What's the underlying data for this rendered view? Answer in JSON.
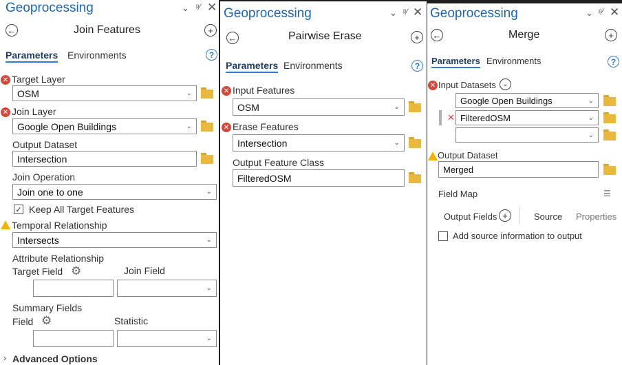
{
  "pane1": {
    "title": "Geoprocessing",
    "tool_name": "Join Features",
    "tab_parameters": "Parameters",
    "tab_environments": "Environments",
    "target_layer_label": "Target Layer",
    "target_layer_value": "OSM",
    "join_layer_label": "Join Layer",
    "join_layer_value": "Google Open Buildings",
    "output_dataset_label": "Output Dataset",
    "output_dataset_value": "Intersection",
    "join_operation_label": "Join Operation",
    "join_operation_value": "Join one to one",
    "keep_all_label": "Keep All Target Features",
    "keep_all_checked": true,
    "temporal_label": "Temporal Relationship",
    "temporal_value": "Intersects",
    "attr_rel_label": "Attribute Relationship",
    "target_field_label": "Target Field",
    "join_field_label": "Join Field",
    "summary_fields_label": "Summary Fields",
    "field_label": "Field",
    "statistic_label": "Statistic",
    "advanced_label": "Advanced Options"
  },
  "pane2": {
    "title": "Geoprocessing",
    "tool_name": "Pairwise Erase",
    "tab_parameters": "Parameters",
    "tab_environments": "Environments",
    "input_features_label": "Input Features",
    "input_features_value": "OSM",
    "erase_features_label": "Erase Features",
    "erase_features_value": "Intersection",
    "output_class_label": "Output Feature Class",
    "output_class_value": "FilteredOSM"
  },
  "pane3": {
    "title": "Geoprocessing",
    "tool_name": "Merge",
    "tab_parameters": "Parameters",
    "tab_environments": "Environments",
    "input_datasets_label": "Input Datasets",
    "input_datasets": [
      "Google Open Buildings",
      "FilteredOSM",
      ""
    ],
    "output_dataset_label": "Output Dataset",
    "output_dataset_value": "Merged",
    "field_map_label": "Field Map",
    "output_fields_label": "Output Fields",
    "source_tab": "Source",
    "properties_tab": "Properties",
    "add_source_label": "Add source information to output",
    "add_source_checked": false
  },
  "icons": {
    "back": "back-arrow-icon",
    "add": "add-icon",
    "help": "help-icon",
    "error": "error-icon",
    "warning": "warning-icon",
    "folder": "folder-icon",
    "gear": "gear-icon",
    "pin": "pin-icon",
    "close": "close-icon",
    "options": "options-menu-icon",
    "field_map": "field-map-icon"
  },
  "colors": {
    "title_blue": "#1a66b3",
    "error_red": "#d24a3c",
    "warning_yellow": "#f2b400",
    "folder_yellow": "#e8b93c",
    "tab_underline": "#2a7fd4"
  }
}
